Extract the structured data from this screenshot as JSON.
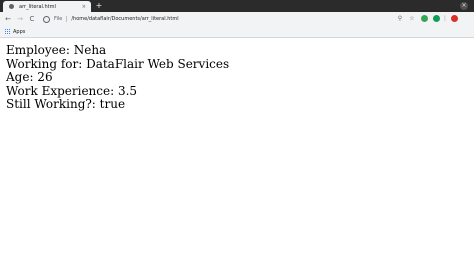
{
  "browser": {
    "tab_title": "arr_literal.html",
    "tab_close": "×",
    "new_tab": "+",
    "url_scheme_label": "File",
    "url": "/home/dataflair/Documents/arr_literal.html",
    "bookmarks_apps_label": "Apps"
  },
  "icons": {
    "favicon": "globe-icon",
    "back": "←",
    "forward": "→",
    "reload": "C",
    "zoom": "⚲",
    "star": "☆",
    "menu": "⋮"
  },
  "page": {
    "lines": [
      "Employee: Neha",
      "Working for: DataFlair Web Services",
      "Age: 26",
      "Work Experience: 3.5",
      "Still Working?: true"
    ]
  }
}
